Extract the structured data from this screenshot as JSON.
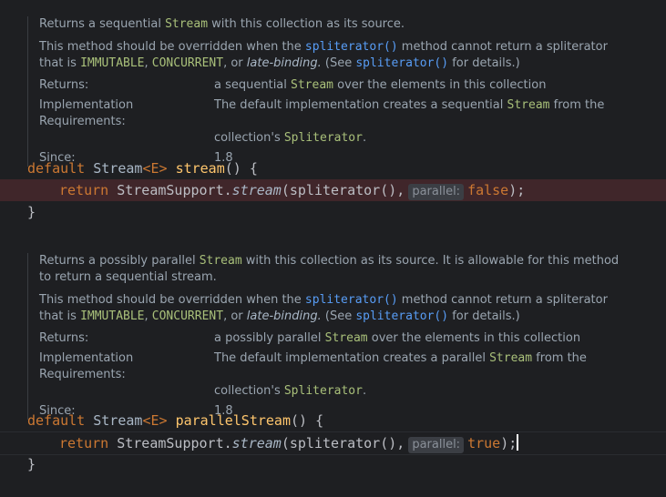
{
  "doc1": {
    "summary_pre": "Returns a sequential ",
    "summary_code": "Stream",
    "summary_post": " with this collection as its source.",
    "override_pre": "This method should be overridden when the ",
    "override_link": "spliterator()",
    "override_mid": " method cannot return a spliterator",
    "override2_pre": "that is ",
    "immutable": "IMMUTABLE",
    "comma": ", ",
    "concurrent": "CONCURRENT",
    "or": ", or ",
    "late": "late-binding.",
    "see": " (See ",
    "see_link": "spliterator()",
    "see_post": " for details.)",
    "returns_label": "Returns:",
    "returns_pre": "a sequential ",
    "returns_code": "Stream",
    "returns_post": " over the elements in this collection",
    "impl_label": "Implementation Requirements:",
    "impl_pre": "The default implementation creates a sequential ",
    "impl_code": "Stream",
    "impl_post": " from the",
    "impl2_pre": "collection's ",
    "impl2_code": "Spliterator",
    "impl2_post": ".",
    "since_label": "Since:",
    "since_val": "1.8"
  },
  "method1": {
    "kw": "default",
    "type": "Stream",
    "generic": "<E>",
    "name": "stream",
    "sig_tail": "() {",
    "ret_kw": "return",
    "cls": "StreamSupport.",
    "call": "stream",
    "args": "(spliterator(),",
    "hint": "parallel:",
    "lit": "false",
    "end": ");",
    "close": "}"
  },
  "doc2": {
    "summary_pre": "Returns a possibly parallel ",
    "summary_code": "Stream",
    "summary_post": " with this collection as its source. It is allowable for this method",
    "summary2": "to return a sequential stream.",
    "override_pre": "This method should be overridden when the ",
    "override_link": "spliterator()",
    "override_mid": " method cannot return a spliterator",
    "override2_pre": "that is ",
    "immutable": "IMMUTABLE",
    "comma": ", ",
    "concurrent": "CONCURRENT",
    "or": ", or ",
    "late": "late-binding.",
    "see": " (See ",
    "see_link": "spliterator()",
    "see_post": " for details.)",
    "returns_label": "Returns:",
    "returns_pre": "a possibly parallel ",
    "returns_code": "Stream",
    "returns_post": " over the elements in this collection",
    "impl_label": "Implementation Requirements:",
    "impl_pre": "The default implementation creates a parallel ",
    "impl_code": "Stream",
    "impl_post": " from the",
    "impl2_pre": "collection's ",
    "impl2_code": "Spliterator",
    "impl2_post": ".",
    "since_label": "Since:",
    "since_val": "1.8"
  },
  "method2": {
    "kw": "default",
    "type": "Stream",
    "generic": "<E>",
    "name": "parallelStream",
    "sig_tail": "() {",
    "ret_kw": "return",
    "cls": "StreamSupport.",
    "call": "stream",
    "args": "(spliterator(),",
    "hint": "parallel:",
    "lit": "true",
    "end": ");",
    "close": "}"
  }
}
